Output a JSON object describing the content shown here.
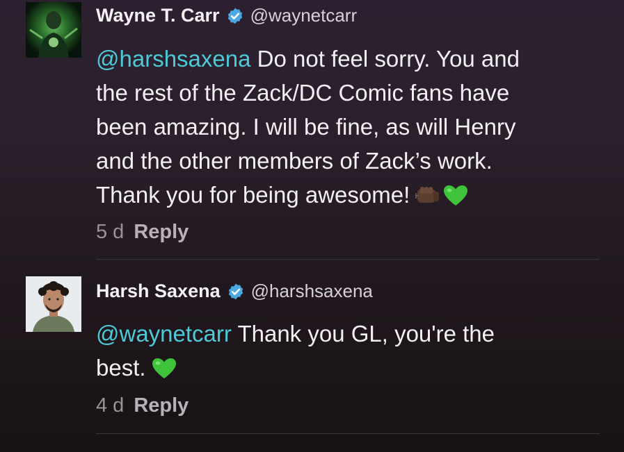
{
  "comments": [
    {
      "name": "Wayne T. Carr",
      "handle": "@waynetcarr",
      "mention": "@harshsaxena",
      "text_line1": " Do not feel sorry. You and",
      "text_rest": "the rest of the Zack/DC Comic fans have\nbeen amazing. I will be fine, as will Henry\nand the other members of Zack’s work.\nThank you for being awesome!",
      "emojis": [
        "fist-bump-icon",
        "green-heart-icon"
      ],
      "time": "5 d",
      "reply_label": "Reply"
    },
    {
      "name": "Harsh Saxena",
      "handle": "@harshsaxena",
      "mention": "@waynetcarr",
      "text_line1": " Thank you GL, you're the",
      "text_rest": "best.",
      "emojis": [
        "green-heart-icon"
      ],
      "time": "4 d",
      "reply_label": "Reply"
    }
  ],
  "colors": {
    "mention": "#4ec9d6",
    "verified_badge": "#4aa9e3",
    "background_top": "#2c2030",
    "background_bottom": "#171214"
  }
}
